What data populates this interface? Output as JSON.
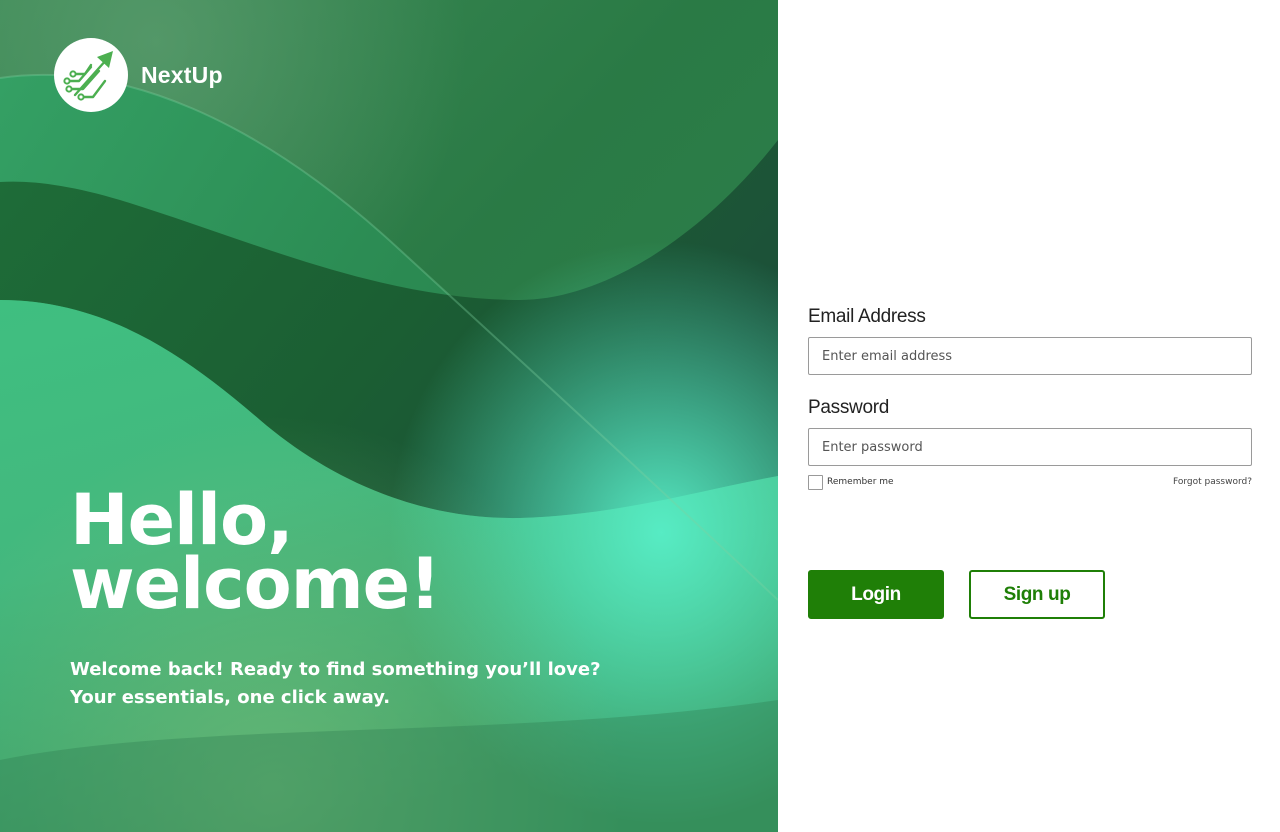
{
  "colors": {
    "primary_green": "#1f7f07",
    "hero_dark": "#1f5a34",
    "hero_light": "#4fe6bf"
  },
  "brand": {
    "name": "NextUp",
    "logo_icon": "growth-arrow-circuit-icon"
  },
  "hero": {
    "title_line1": "Hello,",
    "title_line2": "welcome!",
    "subtitle_line1": "Welcome back! Ready to find something you’ll love?",
    "subtitle_line2": "Your essentials, one click away."
  },
  "form": {
    "email_label": "Email Address",
    "email_placeholder": "Enter email address",
    "email_value": "",
    "password_label": "Password",
    "password_placeholder": "Enter password",
    "password_value": "",
    "remember_label": "Remember me",
    "remember_checked": false,
    "forgot_label": "Forgot password?"
  },
  "buttons": {
    "login_label": "Login",
    "signup_label": "Sign up"
  }
}
